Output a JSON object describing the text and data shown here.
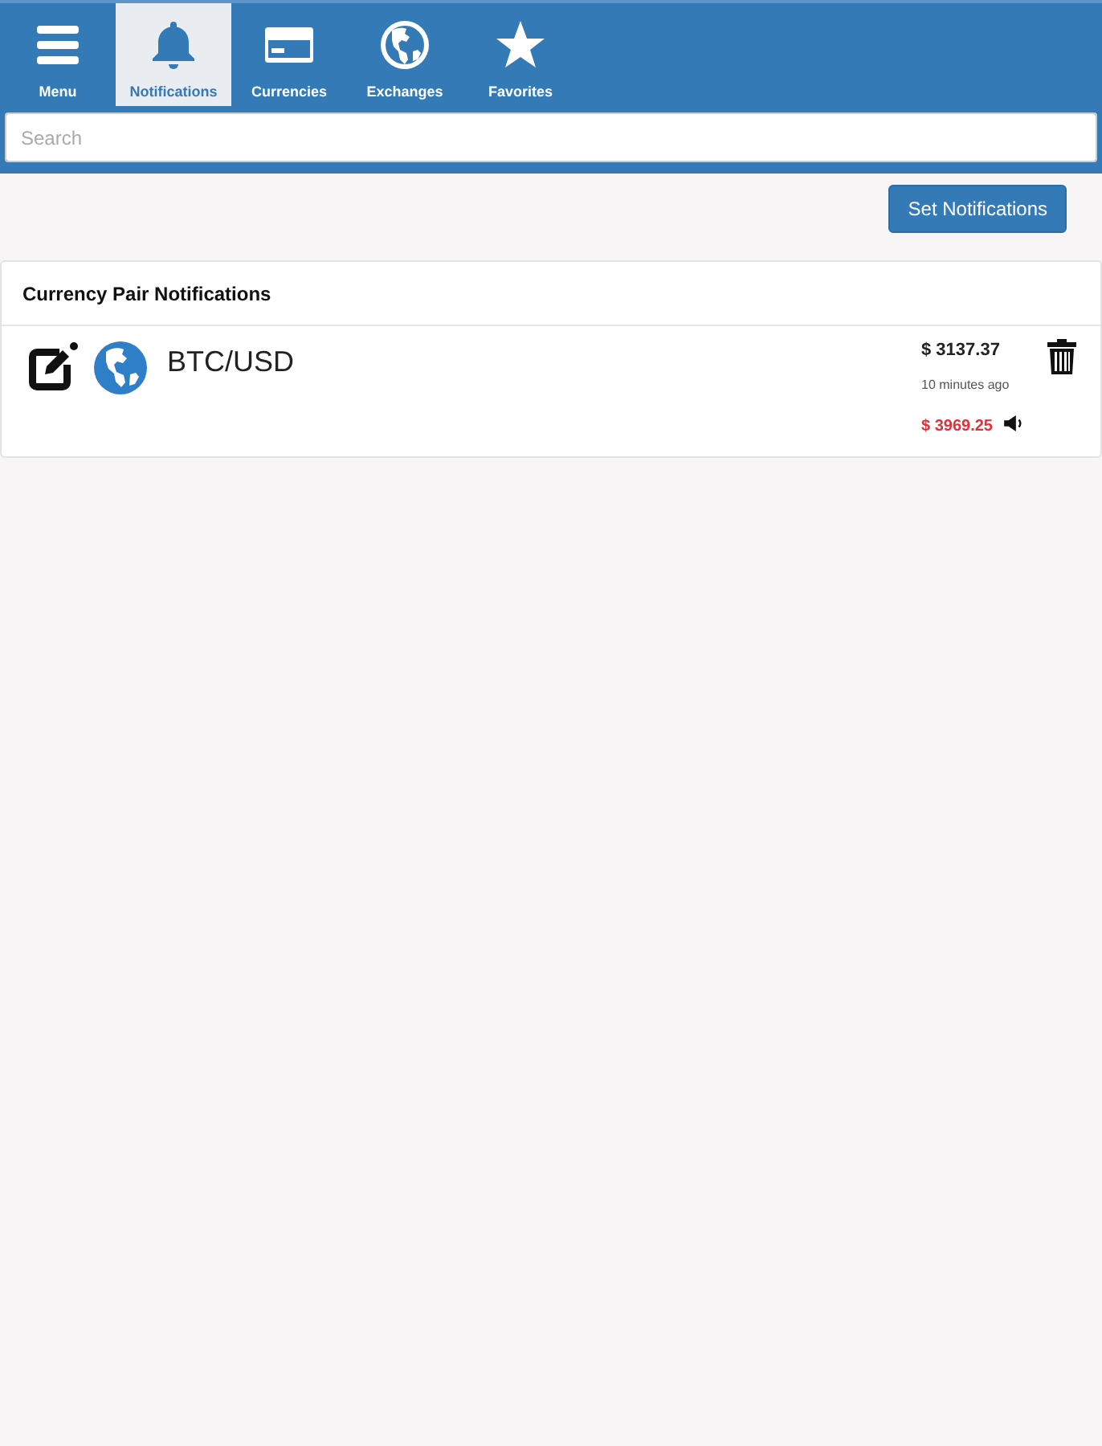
{
  "nav": {
    "tabs": [
      {
        "label": "Menu",
        "kind": "menu",
        "selected": false
      },
      {
        "label": "Notifications",
        "kind": "bell",
        "selected": true
      },
      {
        "label": "Currencies",
        "kind": "card",
        "selected": false
      },
      {
        "label": "Exchanges",
        "kind": "globe",
        "selected": false
      },
      {
        "label": "Favorites",
        "kind": "star",
        "selected": false
      }
    ]
  },
  "search": {
    "placeholder": "Search"
  },
  "set_button": "Set Notifications",
  "panel": {
    "title": "Currency Pair Notifications",
    "items": [
      {
        "pair": "BTC/USD",
        "price": "$ 3137.37",
        "time": "10 minutes ago",
        "alert_price": "$ 3969.25"
      }
    ]
  }
}
